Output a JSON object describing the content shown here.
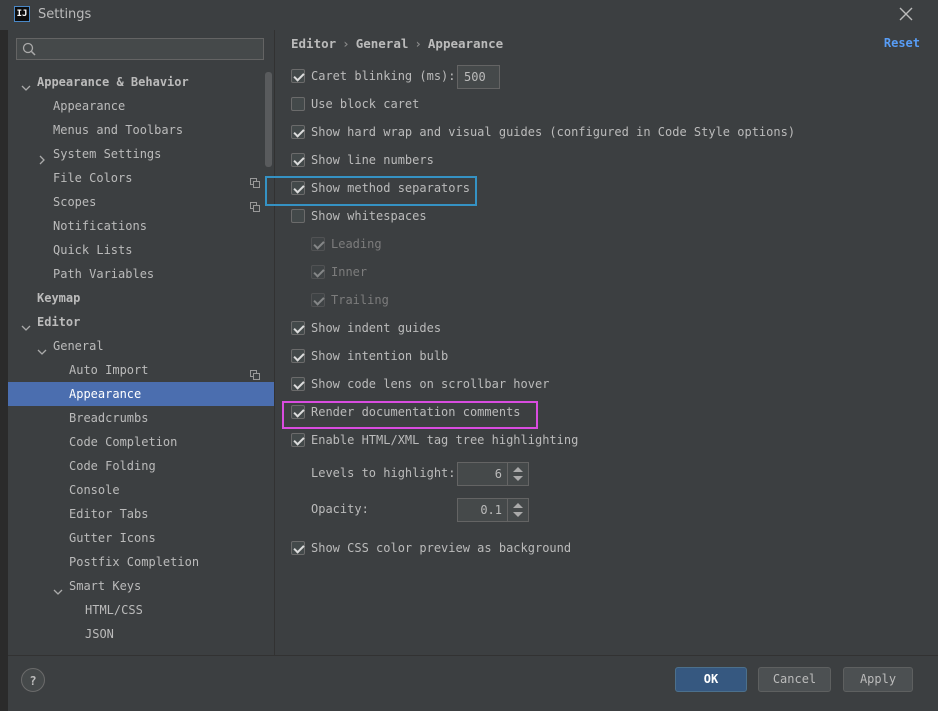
{
  "window": {
    "title": "Settings",
    "app_icon_text": "IJ"
  },
  "search": {
    "placeholder": ""
  },
  "sidebar": {
    "items": [
      {
        "label": "Appearance & Behavior",
        "level": 0,
        "chevron": "down",
        "bold": true
      },
      {
        "label": "Appearance",
        "level": 1
      },
      {
        "label": "Menus and Toolbars",
        "level": 1
      },
      {
        "label": "System Settings",
        "level": 1,
        "chevron": "right"
      },
      {
        "label": "File Colors",
        "level": 1,
        "copy_icon": true
      },
      {
        "label": "Scopes",
        "level": 1,
        "copy_icon": true
      },
      {
        "label": "Notifications",
        "level": 1
      },
      {
        "label": "Quick Lists",
        "level": 1
      },
      {
        "label": "Path Variables",
        "level": 1
      },
      {
        "label": "Keymap",
        "level": 0,
        "bold": true
      },
      {
        "label": "Editor",
        "level": 0,
        "chevron": "down",
        "bold": true
      },
      {
        "label": "General",
        "level": 1,
        "chevron": "down"
      },
      {
        "label": "Auto Import",
        "level": 2,
        "copy_icon": true
      },
      {
        "label": "Appearance",
        "level": 2,
        "selected": true
      },
      {
        "label": "Breadcrumbs",
        "level": 2
      },
      {
        "label": "Code Completion",
        "level": 2
      },
      {
        "label": "Code Folding",
        "level": 2
      },
      {
        "label": "Console",
        "level": 2
      },
      {
        "label": "Editor Tabs",
        "level": 2
      },
      {
        "label": "Gutter Icons",
        "level": 2
      },
      {
        "label": "Postfix Completion",
        "level": 2
      },
      {
        "label": "Smart Keys",
        "level": 2,
        "chevron": "down"
      },
      {
        "label": "HTML/CSS",
        "level": 3
      },
      {
        "label": "JSON",
        "level": 3
      }
    ]
  },
  "breadcrumb": {
    "parts": [
      "Editor",
      "General",
      "Appearance"
    ],
    "separator": "›"
  },
  "reset_label": "Reset",
  "options": [
    {
      "label": "Caret blinking (ms):",
      "checked": true,
      "value": "500"
    },
    {
      "label": "Use block caret",
      "checked": false
    },
    {
      "label": "Show hard wrap and visual guides (configured in Code Style options)",
      "checked": true
    },
    {
      "label": "Show line numbers",
      "checked": true
    },
    {
      "label": "Show method separators",
      "checked": true
    },
    {
      "label": "Show whitespaces",
      "checked": false
    },
    {
      "label": "Leading",
      "checked": true,
      "disabled": true
    },
    {
      "label": "Inner",
      "checked": true,
      "disabled": true
    },
    {
      "label": "Trailing",
      "checked": true,
      "disabled": true
    },
    {
      "label": "Show indent guides",
      "checked": true
    },
    {
      "label": "Show intention bulb",
      "checked": true
    },
    {
      "label": "Show code lens on scrollbar hover",
      "checked": true
    },
    {
      "label": "Render documentation comments",
      "checked": true
    },
    {
      "label": "Enable HTML/XML tag tree highlighting",
      "checked": true
    },
    {
      "label": "Show CSS color preview as background",
      "checked": true
    }
  ],
  "levels": {
    "label": "Levels to highlight:",
    "value": "6"
  },
  "opacity": {
    "label": "Opacity:",
    "value": "0.1"
  },
  "footer": {
    "help": "?",
    "ok": "OK",
    "cancel": "Cancel",
    "apply": "Apply"
  },
  "colors": {
    "accent": "#4b6eaf",
    "link": "#589df6",
    "highlight_blue": "#3592c4",
    "highlight_magenta": "#d94ce0"
  }
}
